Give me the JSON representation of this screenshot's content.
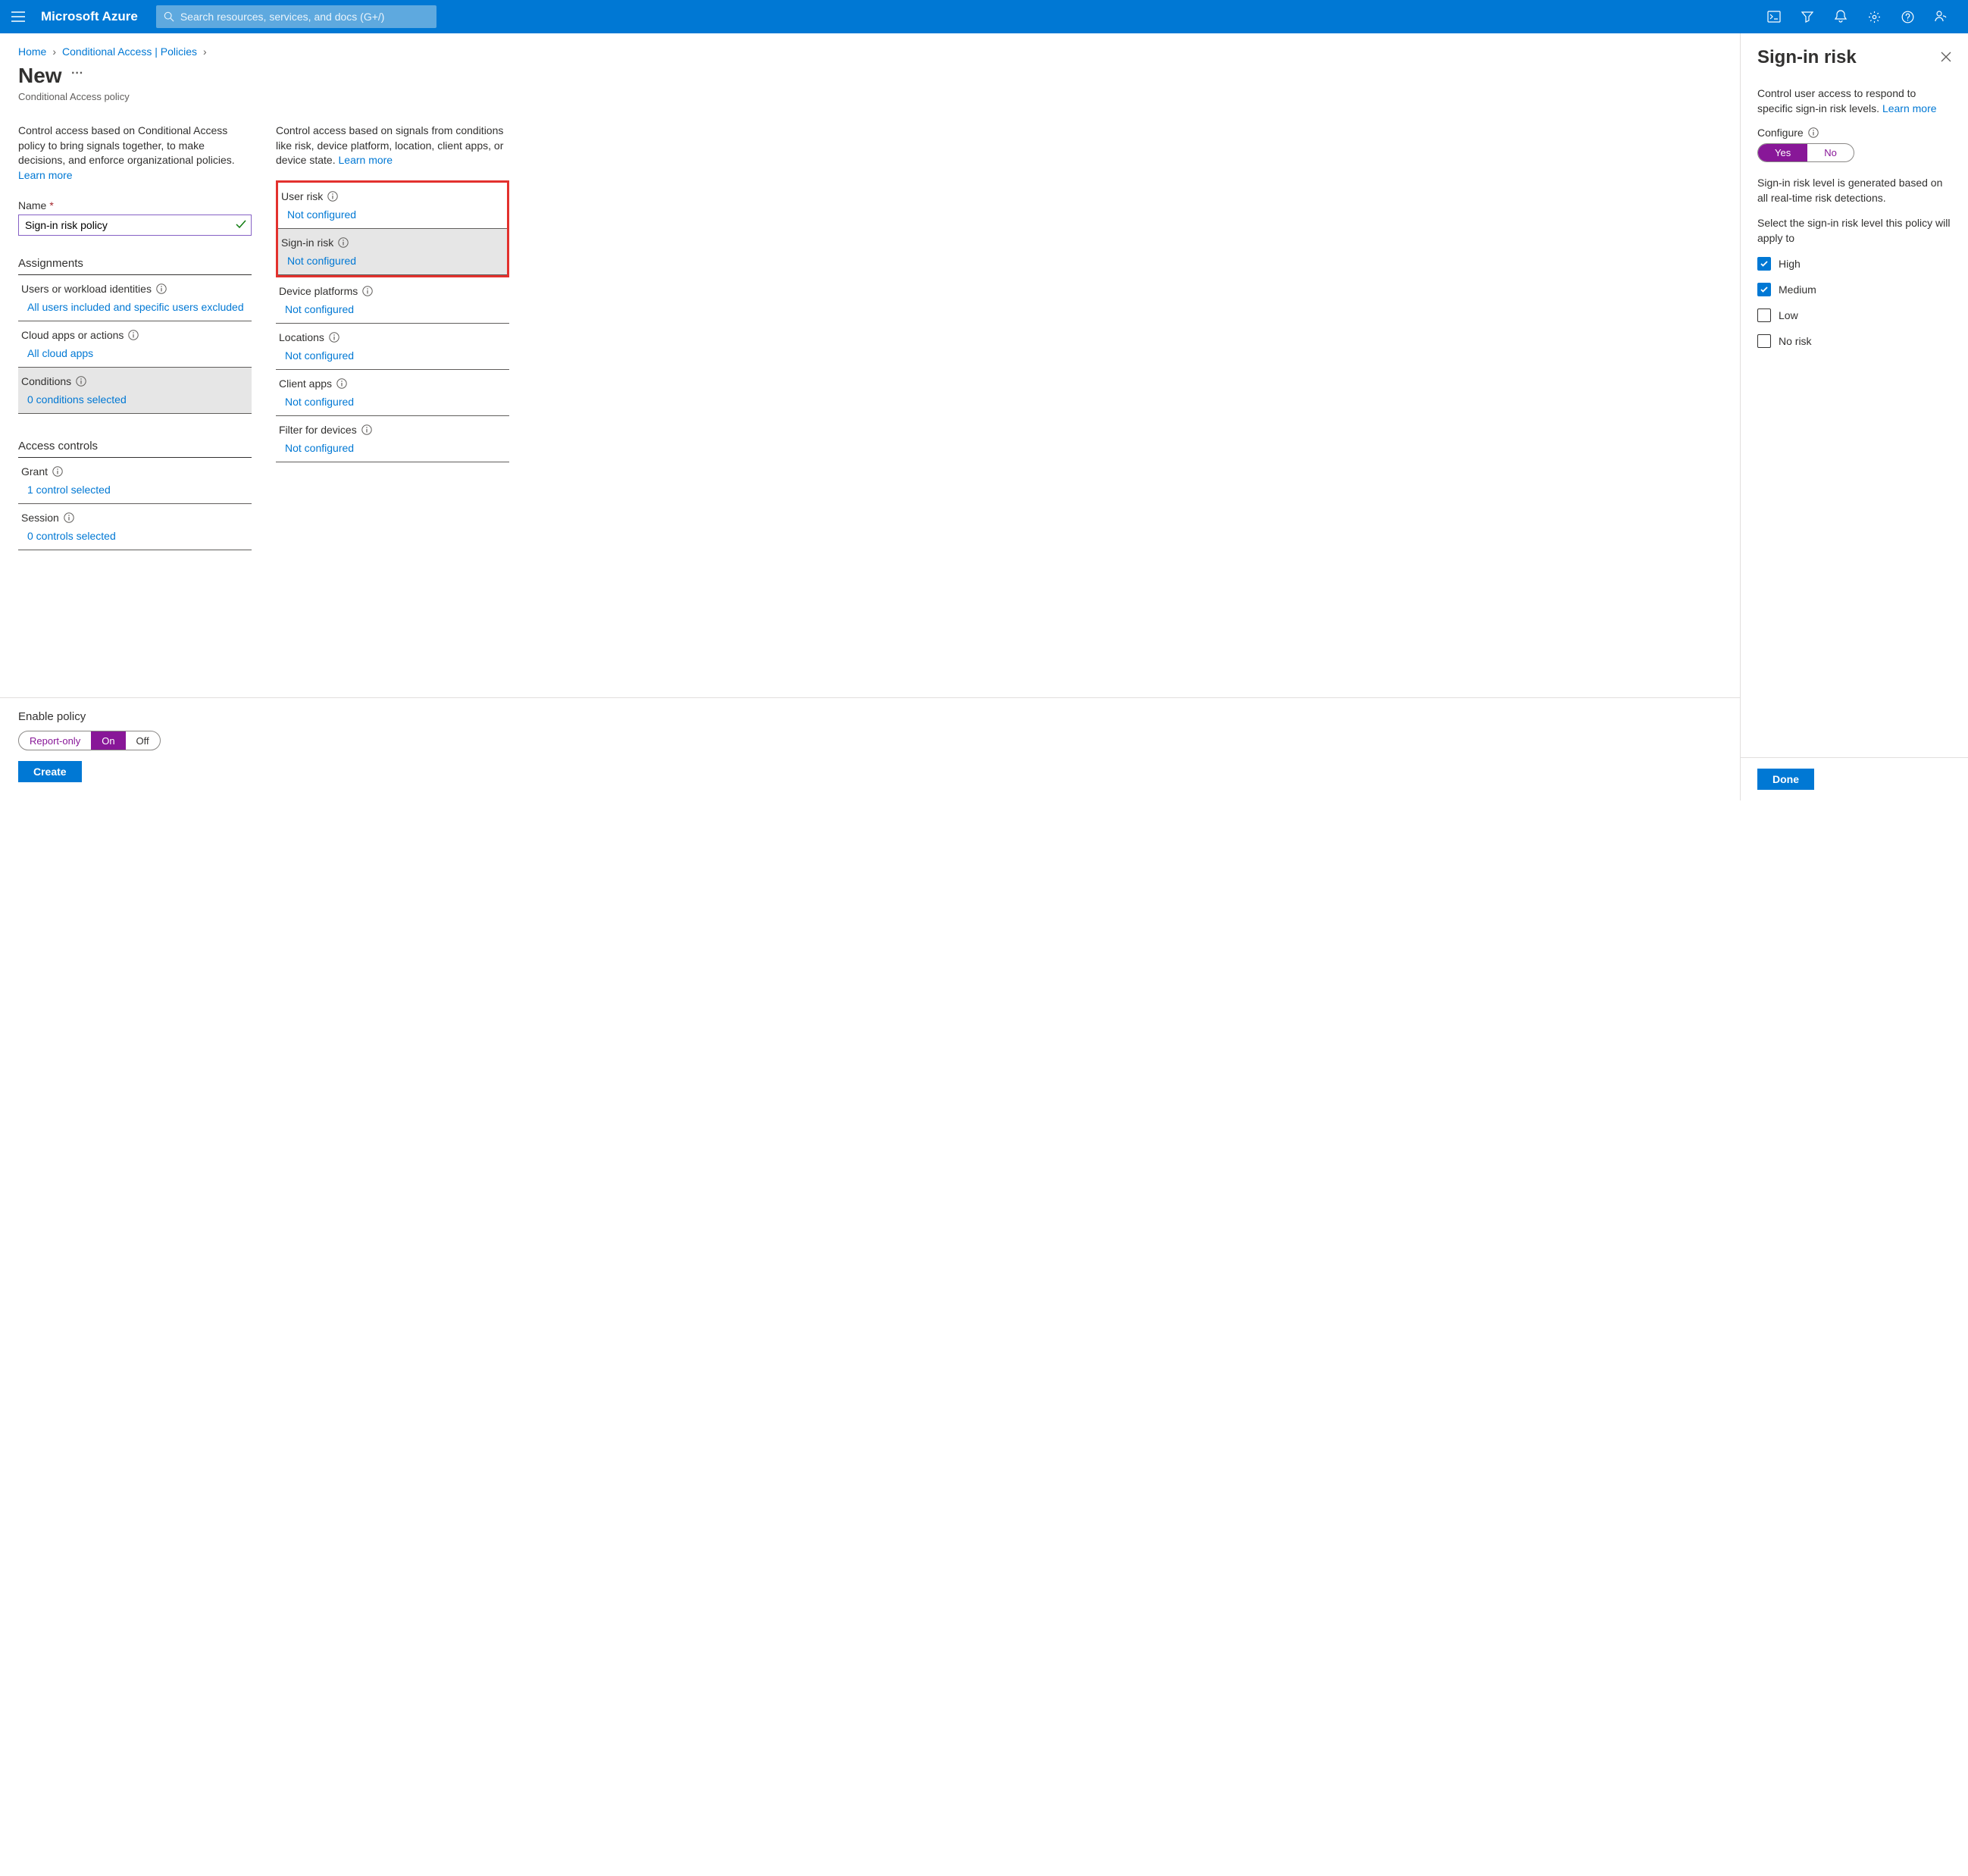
{
  "brand": "Microsoft Azure",
  "search": {
    "placeholder": "Search resources, services, and docs (G+/)"
  },
  "breadcrumb": {
    "home": "Home",
    "ca": "Conditional Access | Policies"
  },
  "page": {
    "title": "New",
    "subtitle": "Conditional Access policy"
  },
  "left": {
    "desc": "Control access based on Conditional Access policy to bring signals together, to make decisions, and enforce organizational policies.",
    "learn": "Learn more",
    "name_label": "Name",
    "name_value": "Sign-in risk policy",
    "assignments_hdr": "Assignments",
    "users": {
      "label": "Users or workload identities",
      "value": "All users included and specific users excluded"
    },
    "apps": {
      "label": "Cloud apps or actions",
      "value": "All cloud apps"
    },
    "conds": {
      "label": "Conditions",
      "value": "0 conditions selected"
    },
    "access_hdr": "Access controls",
    "grant": {
      "label": "Grant",
      "value": "1 control selected"
    },
    "session": {
      "label": "Session",
      "value": "0 controls selected"
    }
  },
  "mid": {
    "desc": "Control access based on signals from conditions like risk, device platform, location, client apps, or device state.",
    "learn": "Learn more",
    "user_risk": {
      "label": "User risk",
      "value": "Not configured"
    },
    "signin_risk": {
      "label": "Sign-in risk",
      "value": "Not configured"
    },
    "platforms": {
      "label": "Device platforms",
      "value": "Not configured"
    },
    "locations": {
      "label": "Locations",
      "value": "Not configured"
    },
    "clients": {
      "label": "Client apps",
      "value": "Not configured"
    },
    "filter": {
      "label": "Filter for devices",
      "value": "Not configured"
    }
  },
  "footer": {
    "enable_label": "Enable policy",
    "opts": {
      "report": "Report-only",
      "on": "On",
      "off": "Off"
    },
    "create": "Create"
  },
  "panel": {
    "title": "Sign-in risk",
    "intro": "Control user access to respond to specific sign-in risk levels.",
    "learn": "Learn more",
    "configure": "Configure",
    "yes": "Yes",
    "no": "No",
    "gen": "Sign-in risk level is generated based on all real-time risk detections.",
    "select": "Select the sign-in risk level this policy will apply to",
    "levels": {
      "high": {
        "label": "High",
        "checked": true
      },
      "medium": {
        "label": "Medium",
        "checked": true
      },
      "low": {
        "label": "Low",
        "checked": false
      },
      "norisk": {
        "label": "No risk",
        "checked": false
      }
    },
    "done": "Done"
  }
}
